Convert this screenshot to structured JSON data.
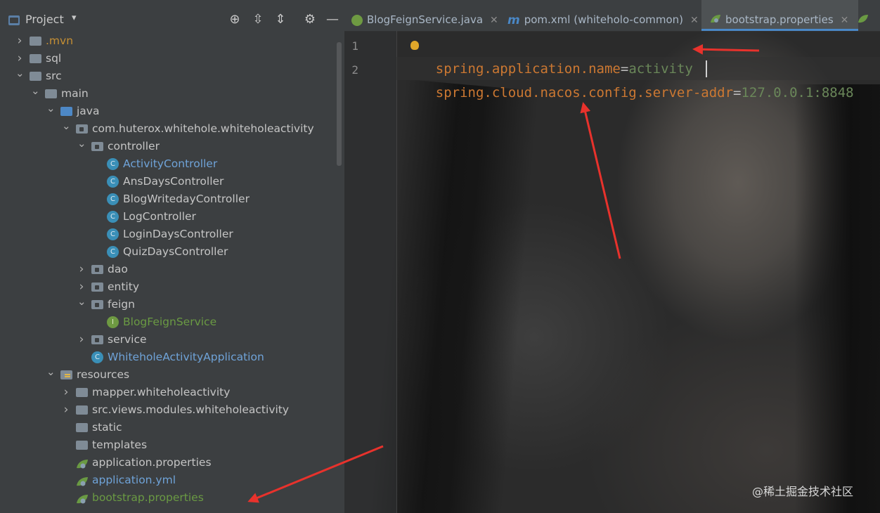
{
  "panel": {
    "title": "Project",
    "tools": [
      "target-icon",
      "expand-all-icon",
      "collapse-all-icon",
      "gear-icon",
      "minimize-icon"
    ]
  },
  "tree": [
    {
      "label": ".mvn",
      "depth": 2,
      "arrow": "›",
      "icon": "folder",
      "color": "orange"
    },
    {
      "label": "sql",
      "depth": 2,
      "arrow": "›",
      "icon": "folder",
      "color": "default"
    },
    {
      "label": "src",
      "depth": 2,
      "arrow": "⌄",
      "icon": "folder",
      "color": "default"
    },
    {
      "label": "main",
      "depth": 3,
      "arrow": "⌄",
      "icon": "folder",
      "color": "default"
    },
    {
      "label": "java",
      "depth": 4,
      "arrow": "⌄",
      "icon": "folder-blue",
      "color": "default"
    },
    {
      "label": "com.huterox.whitehole.whiteholeactivity",
      "depth": 5,
      "arrow": "⌄",
      "icon": "package",
      "color": "default"
    },
    {
      "label": "controller",
      "depth": 6,
      "arrow": "⌄",
      "icon": "package",
      "color": "default"
    },
    {
      "label": "ActivityController",
      "depth": 7,
      "arrow": "",
      "icon": "class",
      "color": "blue"
    },
    {
      "label": "AnsDaysController",
      "depth": 7,
      "arrow": "",
      "icon": "class",
      "color": "default"
    },
    {
      "label": "BlogWritedayController",
      "depth": 7,
      "arrow": "",
      "icon": "class",
      "color": "default"
    },
    {
      "label": "LogController",
      "depth": 7,
      "arrow": "",
      "icon": "class",
      "color": "default"
    },
    {
      "label": "LoginDaysController",
      "depth": 7,
      "arrow": "",
      "icon": "class",
      "color": "default"
    },
    {
      "label": "QuizDaysController",
      "depth": 7,
      "arrow": "",
      "icon": "class",
      "color": "default"
    },
    {
      "label": "dao",
      "depth": 6,
      "arrow": "›",
      "icon": "package",
      "color": "default"
    },
    {
      "label": "entity",
      "depth": 6,
      "arrow": "›",
      "icon": "package",
      "color": "default"
    },
    {
      "label": "feign",
      "depth": 6,
      "arrow": "⌄",
      "icon": "package",
      "color": "default"
    },
    {
      "label": "BlogFeignService",
      "depth": 7,
      "arrow": "",
      "icon": "interface",
      "color": "green"
    },
    {
      "label": "service",
      "depth": 6,
      "arrow": "›",
      "icon": "package",
      "color": "default"
    },
    {
      "label": "WhiteholeActivityApplication",
      "depth": 6,
      "arrow": "",
      "icon": "spring-class",
      "color": "blue"
    },
    {
      "label": "resources",
      "depth": 4,
      "arrow": "⌄",
      "icon": "resources",
      "color": "default"
    },
    {
      "label": "mapper.whiteholeactivity",
      "depth": 5,
      "arrow": "›",
      "icon": "folder",
      "color": "default"
    },
    {
      "label": "src.views.modules.whiteholeactivity",
      "depth": 5,
      "arrow": "›",
      "icon": "folder",
      "color": "default"
    },
    {
      "label": "static",
      "depth": 5,
      "arrow": "",
      "icon": "folder",
      "color": "default"
    },
    {
      "label": "templates",
      "depth": 5,
      "arrow": "",
      "icon": "folder",
      "color": "default"
    },
    {
      "label": "application.properties",
      "depth": 5,
      "arrow": "",
      "icon": "spring-leaf",
      "color": "default"
    },
    {
      "label": "application.yml",
      "depth": 5,
      "arrow": "",
      "icon": "spring-leaf",
      "color": "blue"
    },
    {
      "label": "bootstrap.properties",
      "depth": 5,
      "arrow": "",
      "icon": "spring-leaf",
      "color": "green"
    }
  ],
  "tabs": [
    {
      "label": "BlogFeignService.java",
      "icon": "interface-icon",
      "active": false
    },
    {
      "label": "pom.xml (whiteholo-common)",
      "icon": "maven-icon",
      "active": false
    },
    {
      "label": "bootstrap.properties",
      "icon": "spring-leaf-icon",
      "active": true
    }
  ],
  "editor": {
    "lines": [
      {
        "number": "1",
        "key": "spring.application.name",
        "eq": "=",
        "value": "activity"
      },
      {
        "number": "2",
        "key": "spring.cloud.nacos.config.server-addr",
        "eq": "=",
        "value": "127.0.0.1:8848"
      }
    ]
  },
  "watermark": "@稀土掘金技术社区",
  "colors": {
    "panel_bg": "#3c3f41",
    "editor_bg": "#2b2b2b",
    "key": "#cc7832",
    "value": "#6a8759",
    "arrow": "#e8322c",
    "tab_underline": "#4a88c7"
  }
}
